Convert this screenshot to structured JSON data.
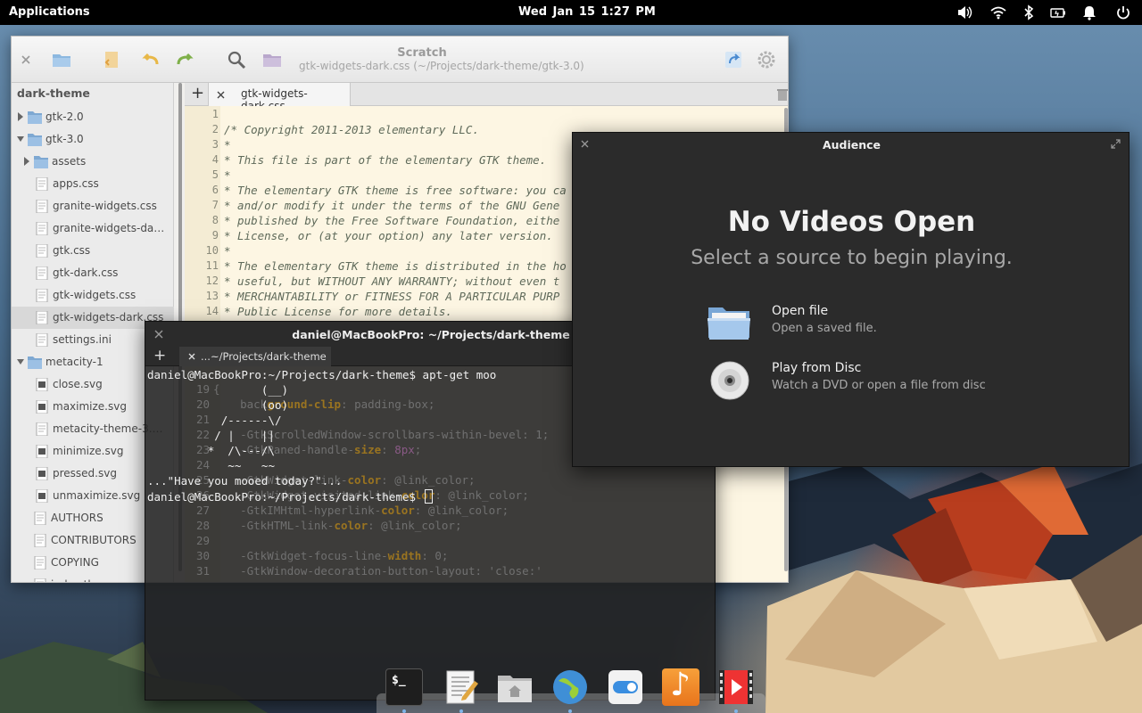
{
  "panel": {
    "applications": "Applications",
    "clock": "Wed Jan 15  1:27 PM",
    "indicators": [
      "volume-icon",
      "wifi-icon",
      "bluetooth-icon",
      "battery-icon",
      "notifications-icon",
      "power-icon"
    ]
  },
  "scratch": {
    "title": "Scratch",
    "subtitle": "gtk-widgets-dark.css (~/Projects/dark-theme/gtk-3.0)",
    "sidebar_header": "dark-theme",
    "tree": [
      {
        "label": "gtk-2.0",
        "kind": "folder",
        "expanded": false
      },
      {
        "label": "gtk-3.0",
        "kind": "folder",
        "expanded": true
      },
      {
        "label": "assets",
        "kind": "folder",
        "expanded": false
      },
      {
        "label": "apps.css",
        "kind": "file"
      },
      {
        "label": "granite-widgets.css",
        "kind": "file"
      },
      {
        "label": "granite-widgets-dark....",
        "kind": "file"
      },
      {
        "label": "gtk.css",
        "kind": "file"
      },
      {
        "label": "gtk-dark.css",
        "kind": "file"
      },
      {
        "label": "gtk-widgets.css",
        "kind": "file"
      },
      {
        "label": "gtk-widgets-dark.css",
        "kind": "file",
        "selected": true
      },
      {
        "label": "settings.ini",
        "kind": "file"
      },
      {
        "label": "metacity-1",
        "kind": "folder",
        "expanded": true
      },
      {
        "label": "close.svg",
        "kind": "image"
      },
      {
        "label": "maximize.svg",
        "kind": "image"
      },
      {
        "label": "metacity-theme-3.xml",
        "kind": "file"
      },
      {
        "label": "minimize.svg",
        "kind": "image"
      },
      {
        "label": "pressed.svg",
        "kind": "image"
      },
      {
        "label": "unmaximize.svg",
        "kind": "image"
      },
      {
        "label": "AUTHORS",
        "kind": "file"
      },
      {
        "label": "CONTRIBUTORS",
        "kind": "file"
      },
      {
        "label": "COPYING",
        "kind": "file"
      },
      {
        "label": "index.theme",
        "kind": "file"
      }
    ],
    "tab_label": "gtk-widgets-dark.css",
    "code_lines": [
      {
        "n": "1",
        "text": ""
      },
      {
        "n": "2",
        "text": "/* Copyright 2011-2013 elementary LLC."
      },
      {
        "n": "3",
        "text": "*"
      },
      {
        "n": "4",
        "text": "* This file is part of the elementary GTK theme."
      },
      {
        "n": "5",
        "text": "*"
      },
      {
        "n": "6",
        "text": "* The elementary GTK theme is free software: you ca"
      },
      {
        "n": "7",
        "text": "* and/or modify it under the terms of the GNU Gene"
      },
      {
        "n": "8",
        "text": "* published by the Free Software Foundation, eithe"
      },
      {
        "n": "9",
        "text": "* License, or (at your option) any later version."
      },
      {
        "n": "10",
        "text": "*"
      },
      {
        "n": "11",
        "text": "* The elementary GTK theme is distributed in the ho"
      },
      {
        "n": "12",
        "text": "* useful, but WITHOUT ANY WARRANTY; without even t"
      },
      {
        "n": "13",
        "text": "* MERCHANTABILITY or FITNESS FOR A PARTICULAR PURP"
      },
      {
        "n": "14",
        "text": "* Public License for more details."
      }
    ],
    "ghost_lines": [
      {
        "n": "19",
        "text": "{"
      },
      {
        "n": "20",
        "pre": "    back",
        "kw": "ground-clip",
        "post": ": padding-box;"
      },
      {
        "n": "21",
        "text": ""
      },
      {
        "n": "22",
        "pre": "    -GtkScrolledWindow-scrollbars-within-bevel: 1;",
        "kw": "",
        "post": ""
      },
      {
        "n": "23",
        "pre": "    -GtkPaned-handle-",
        "kw": "size",
        "post": ": ",
        "num": "8px",
        "tail": ";"
      },
      {
        "n": "24",
        "text": ""
      },
      {
        "n": "25",
        "pre": "    -GtkWidget-link-",
        "kw": "color",
        "post": ": @link_color;"
      },
      {
        "n": "26",
        "pre": "    -GtkWidget-visited-link-",
        "kw": "color",
        "post": ": @link_color;"
      },
      {
        "n": "27",
        "pre": "    -GtkIMHtml-hyperlink-",
        "kw": "color",
        "post": ": @link_color;"
      },
      {
        "n": "28",
        "pre": "    -GtkHTML-link-",
        "kw": "color",
        "post": ": @link_color;"
      },
      {
        "n": "29",
        "text": ""
      },
      {
        "n": "30",
        "pre": "    -GtkWidget-focus-line-",
        "kw": "width",
        "post": ": 0;"
      },
      {
        "n": "31",
        "pre": "    -GtkWindow-decoration-button-layout: 'close:'",
        "kw": "",
        "post": ""
      }
    ]
  },
  "terminal": {
    "title": "daniel@MacBookPro: ~/Projects/dark-theme",
    "tab_label": "...~/Projects/dark-theme",
    "lines": [
      "daniel@MacBookPro:~/Projects/dark-theme$ apt-get moo",
      "                 (__)",
      "                 (oo)",
      "           /------\\/",
      "          / |    ||",
      "         *  /\\---/\\",
      "            ~~   ~~",
      "...\"Have you mooed today?\"...",
      "daniel@MacBookPro:~/Projects/dark-theme$ "
    ]
  },
  "audience": {
    "title": "Audience",
    "heading": "No Videos Open",
    "subheading": "Select a source to begin playing.",
    "actions": [
      {
        "title": "Open file",
        "subtitle": "Open a saved file.",
        "icon": "folder-icon"
      },
      {
        "title": "Play from Disc",
        "subtitle": "Watch a DVD or open a file from disc",
        "icon": "disc-icon"
      }
    ]
  },
  "dock": {
    "items": [
      {
        "name": "terminal",
        "label": "$_"
      },
      {
        "name": "text-editor",
        "label": ""
      },
      {
        "name": "files",
        "label": ""
      },
      {
        "name": "web-browser",
        "label": ""
      },
      {
        "name": "system-settings",
        "label": ""
      },
      {
        "name": "music",
        "label": "♪"
      },
      {
        "name": "videos",
        "label": ""
      }
    ]
  }
}
